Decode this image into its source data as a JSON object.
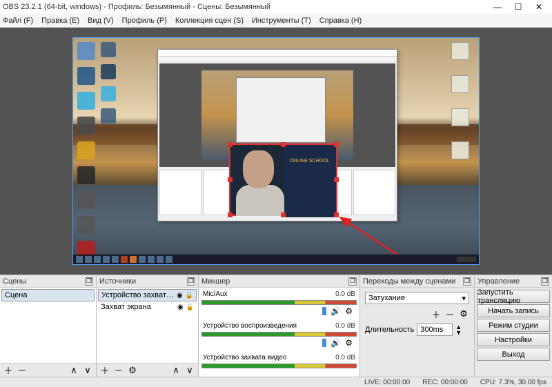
{
  "window": {
    "title": "OBS 23.2.1 (64-bit, windows) - Профиль: Безымянный - Сцены: Безымянный"
  },
  "menu": {
    "file": "Файл (F)",
    "edit": "Правка (E)",
    "view": "Вид (V)",
    "profile": "Профиль (P)",
    "scene_collection": "Коллекция сцен (S)",
    "tools": "Инструменты (T)",
    "help": "Справка (H)"
  },
  "webcam_text": "ONLINE SCHOOL",
  "panels": {
    "scenes": {
      "title": "Сцены",
      "items": [
        "Сцена"
      ]
    },
    "sources": {
      "title": "Источники",
      "items": [
        {
          "name": "Устройство захвата видео",
          "visible": true,
          "locked": true
        },
        {
          "name": "Захват экрана",
          "visible": true,
          "locked": false
        }
      ]
    },
    "mixer": {
      "title": "Микшер",
      "channels": [
        {
          "name": "Mic/Aux",
          "db": "0.0 dB"
        },
        {
          "name": "Устройство воспроизведения",
          "db": "0.0 dB"
        },
        {
          "name": "Устройство захвата видео",
          "db": "0.0 dB"
        }
      ]
    },
    "transitions": {
      "title": "Переходы между сценами",
      "selected": "Затухание",
      "duration_label": "Длительность",
      "duration": "300ms"
    },
    "controls": {
      "title": "Управление",
      "buttons": {
        "start_stream": "Запустить трансляцию",
        "start_record": "Начать запись",
        "studio_mode": "Режим студии",
        "settings": "Настройки",
        "exit": "Выход"
      }
    }
  },
  "status": {
    "live": "LIVE: 00:00:00",
    "rec": "REC: 00:00:00",
    "cpu": "CPU: 7.3%, 30.00 fps"
  }
}
